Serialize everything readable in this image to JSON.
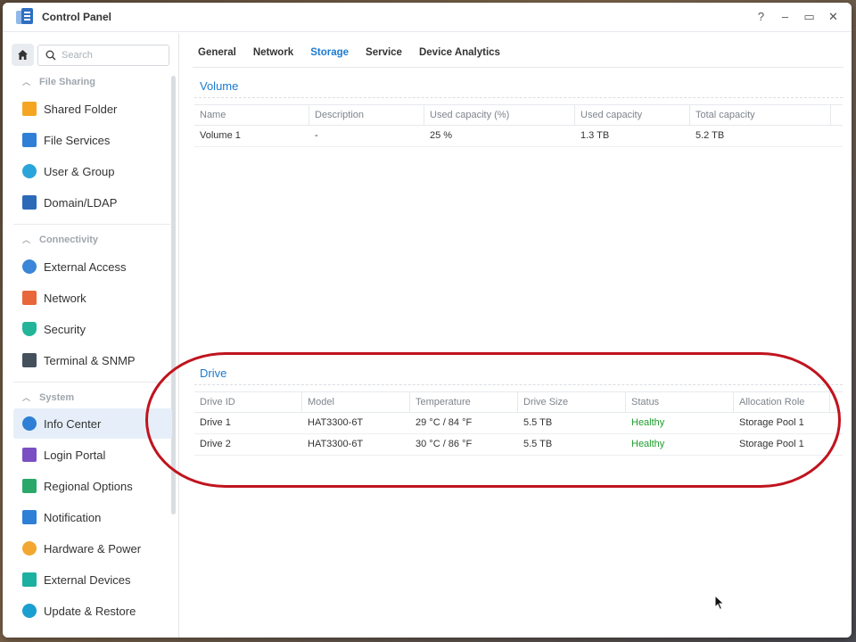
{
  "window": {
    "title": "Control Panel",
    "controls": [
      "?",
      "–",
      "▭",
      "✕"
    ]
  },
  "search": {
    "placeholder": "Search"
  },
  "sidebar": {
    "sections": [
      {
        "label": "File Sharing",
        "items": [
          {
            "label": "Shared Folder",
            "icon": "shared-folder-icon"
          },
          {
            "label": "File Services",
            "icon": "file-services-icon"
          },
          {
            "label": "User & Group",
            "icon": "user-group-icon"
          },
          {
            "label": "Domain/LDAP",
            "icon": "domain-ldap-icon"
          }
        ]
      },
      {
        "label": "Connectivity",
        "items": [
          {
            "label": "External Access",
            "icon": "external-access-icon"
          },
          {
            "label": "Network",
            "icon": "network-icon"
          },
          {
            "label": "Security",
            "icon": "security-shield-icon"
          },
          {
            "label": "Terminal & SNMP",
            "icon": "terminal-icon"
          }
        ]
      },
      {
        "label": "System",
        "items": [
          {
            "label": "Info Center",
            "icon": "info-icon"
          },
          {
            "label": "Login Portal",
            "icon": "login-portal-icon"
          },
          {
            "label": "Regional Options",
            "icon": "regional-options-icon"
          },
          {
            "label": "Notification",
            "icon": "notification-icon"
          },
          {
            "label": "Hardware & Power",
            "icon": "hardware-power-icon"
          },
          {
            "label": "External Devices",
            "icon": "external-devices-icon"
          },
          {
            "label": "Update & Restore",
            "icon": "update-restore-icon"
          }
        ]
      }
    ]
  },
  "tabs": [
    "General",
    "Network",
    "Storage",
    "Service",
    "Device Analytics"
  ],
  "volume": {
    "title": "Volume",
    "columns": [
      "Name",
      "Description",
      "Used capacity (%)",
      "Used capacity",
      "Total capacity"
    ],
    "rows": [
      [
        "Volume 1",
        "-",
        "25 %",
        "1.3 TB",
        "5.2 TB"
      ]
    ]
  },
  "drive": {
    "title": "Drive",
    "columns": [
      "Drive ID",
      "Model",
      "Temperature",
      "Drive Size",
      "Status",
      "Allocation Role"
    ],
    "rows": [
      [
        "Drive 1",
        "HAT3300-6T",
        "29 °C / 84 °F",
        "5.5 TB",
        "Healthy",
        "Storage Pool 1"
      ],
      [
        "Drive 2",
        "HAT3300-6T",
        "30 °C / 86 °F",
        "5.5 TB",
        "Healthy",
        "Storage Pool 1"
      ]
    ]
  },
  "colors": {
    "accent": "#1c7ad0",
    "healthy": "#1d9d2c",
    "highlight": "#c0141e"
  }
}
